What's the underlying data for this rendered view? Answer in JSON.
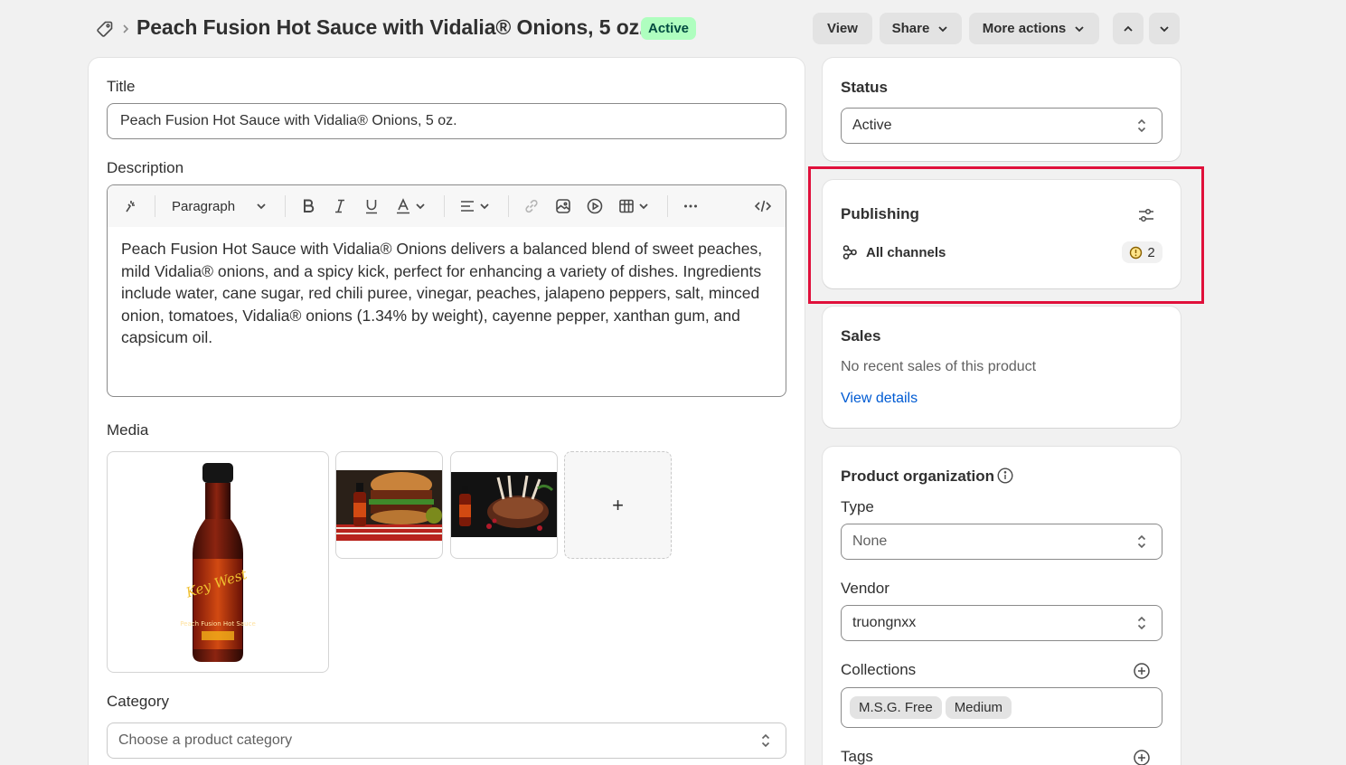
{
  "header": {
    "title": "Peach Fusion Hot Sauce with Vidalia® Onions, 5 oz.",
    "status_badge": "Active",
    "view_label": "View",
    "share_label": "Share",
    "more_actions_label": "More actions"
  },
  "form": {
    "title_label": "Title",
    "title_value": "Peach Fusion Hot Sauce with Vidalia® Onions, 5 oz.",
    "description_label": "Description",
    "paragraph_select": "Paragraph",
    "description_text": "Peach Fusion Hot Sauce with Vidalia® Onions delivers a balanced blend of sweet peaches, mild Vidalia® onions, and a spicy kick, perfect for enhancing a variety of dishes. Ingredients include water, cane sugar, red chili puree, vinegar, peaches, jalapeno peppers, salt, minced onion, tomatoes, Vidalia® onions (1.34% by weight), cayenne pepper, xanthan gum, and capsicum oil.",
    "media_label": "Media",
    "media_add": "+",
    "bottle_brand": "Key West",
    "bottle_label": "Peach Fusion Hot Sauce",
    "category_label": "Category",
    "category_placeholder": "Choose a product category"
  },
  "sidebar": {
    "status": {
      "title": "Status",
      "value": "Active"
    },
    "publishing": {
      "title": "Publishing",
      "channels_label": "All channels",
      "warning_count": "2"
    },
    "sales": {
      "title": "Sales",
      "empty_text": "No recent sales of this product",
      "link": "View details"
    },
    "organization": {
      "title": "Product organization",
      "type_label": "Type",
      "type_value": "None",
      "vendor_label": "Vendor",
      "vendor_value": "truongnxx",
      "collections_label": "Collections",
      "collections": [
        "M.S.G. Free",
        "Medium"
      ],
      "tags_label": "Tags"
    }
  },
  "colors": {
    "highlight": "#e0103b",
    "badge_bg": "#affebf",
    "link": "#005bd3"
  }
}
